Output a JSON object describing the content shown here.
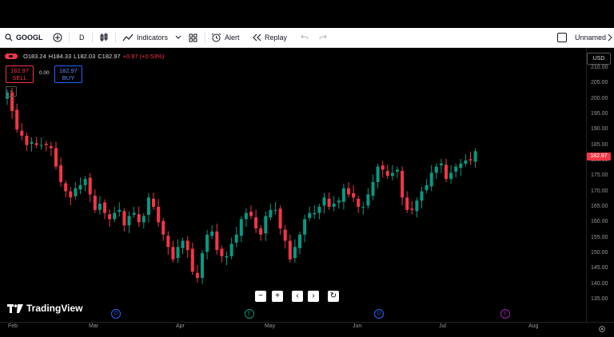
{
  "toolbar": {
    "symbol": "GOOGL",
    "interval": "D",
    "indicators": "Indicators",
    "alert": "Alert",
    "replay": "Replay",
    "layout_name": "Unnamed"
  },
  "legend": {
    "open": "O183.24",
    "high": "H184.33",
    "low": "L182.03",
    "close": "C182.97",
    "change": "+0.97 (+0.53%)"
  },
  "trade": {
    "sell_price": "182.97",
    "sell_label": "SELL",
    "spread": "0.00",
    "buy_price": "182.97",
    "buy_label": "BUY"
  },
  "currency": "USD",
  "last_price_label": "182.97",
  "branding": "TradingView",
  "events": [
    {
      "letter": "D",
      "color": "#2962ff"
    },
    {
      "letter": "E",
      "color": "#089981"
    },
    {
      "letter": "D",
      "color": "#2962ff"
    },
    {
      "letter": "E",
      "color": "#9c27b0"
    }
  ],
  "colors": {
    "up": "#089981",
    "down": "#f23645",
    "accent": "#2962ff"
  },
  "chart_data": {
    "type": "candlestick",
    "y_ticks": [
      "210.00",
      "205.00",
      "200.00",
      "195.00",
      "190.00",
      "185.00",
      "180.00",
      "175.00",
      "170.00",
      "165.00",
      "160.00",
      "155.00",
      "150.00",
      "145.00",
      "140.00",
      "135.00"
    ],
    "x_ticks": [
      "Feb",
      "Mar",
      "Apr",
      "May",
      "Jun",
      "Jul",
      "Aug"
    ],
    "ylim": [
      135,
      211
    ],
    "closes": [
      202,
      196,
      190,
      188,
      185,
      186,
      185,
      185,
      185,
      184,
      178,
      173,
      170,
      168,
      171,
      172,
      174,
      169,
      164,
      166,
      163,
      161,
      163,
      164,
      159,
      162,
      163,
      160,
      162,
      168,
      165,
      160,
      156,
      152,
      148,
      152,
      154,
      151,
      144,
      142,
      150,
      156,
      157,
      151,
      149,
      149,
      153,
      156,
      161,
      163,
      162,
      158,
      156,
      162,
      164,
      164,
      158,
      154,
      148,
      152,
      156,
      161,
      163,
      163,
      165,
      168,
      165,
      166,
      167,
      171,
      169,
      168,
      165,
      165,
      169,
      173,
      178,
      177,
      175,
      176,
      177,
      168,
      164,
      164,
      167,
      170,
      172,
      176,
      178,
      179,
      174,
      176,
      178,
      179,
      180,
      180,
      183
    ]
  }
}
